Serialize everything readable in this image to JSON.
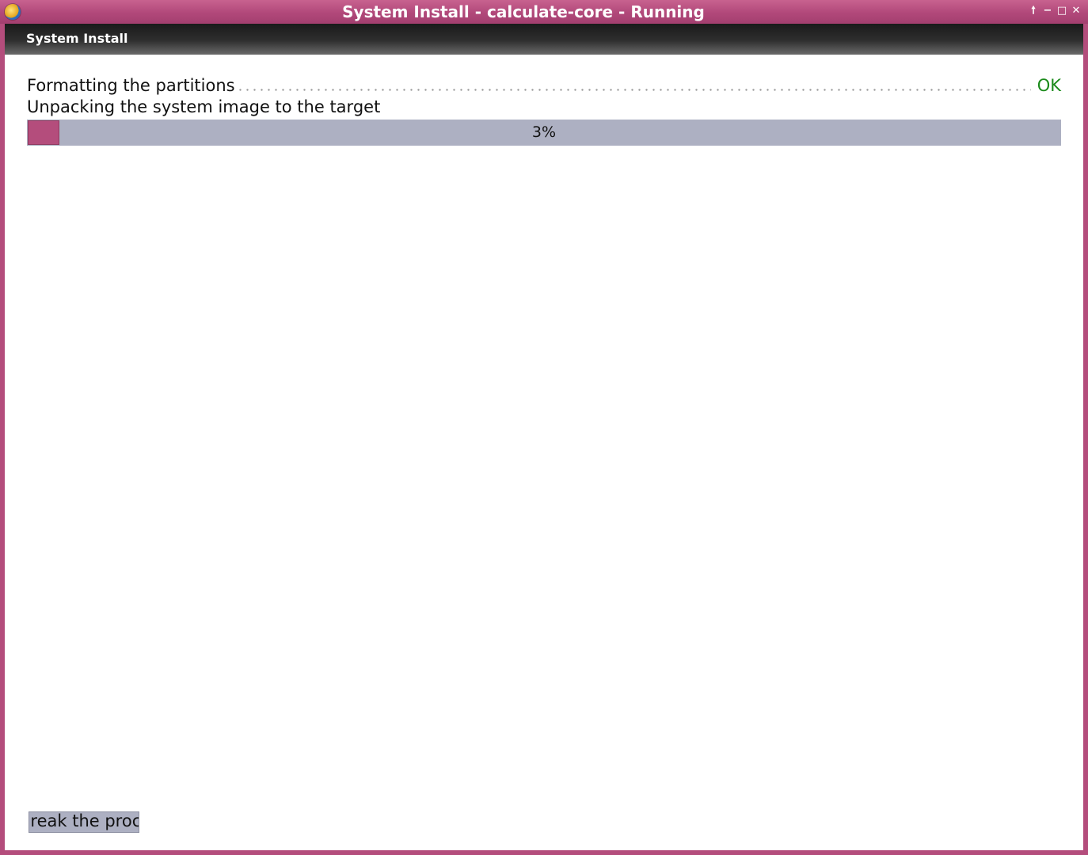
{
  "window": {
    "title": "System Install - calculate-core - Running",
    "controls": {
      "raise": "🠕",
      "minimize": "−",
      "maximize": "□",
      "close": "✕"
    }
  },
  "header": {
    "title": "System Install"
  },
  "steps": [
    {
      "label": "Formatting the partitions",
      "status": "OK"
    },
    {
      "label": "Unpacking the system image to the target"
    }
  ],
  "progress": {
    "value": 3,
    "label": "3%"
  },
  "actions": {
    "break_label": "Break the process"
  },
  "colors": {
    "accent": "#b44d7c",
    "progress_track": "#adb0c2",
    "ok": "#1a8a1a"
  }
}
